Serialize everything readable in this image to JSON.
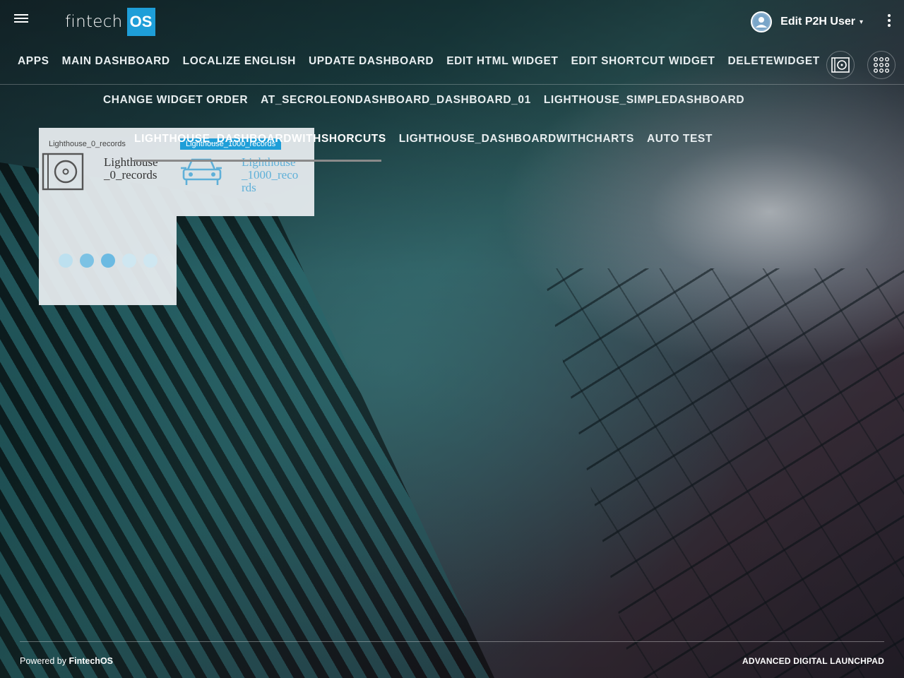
{
  "header": {
    "logo_text": "fintech",
    "logo_box": "OS",
    "user_name": "Edit P2H User",
    "caret": "▾"
  },
  "nav": {
    "row1": [
      "APPS",
      "MAIN DASHBOARD",
      "LOCALIZE ENGLISH",
      "UPDATE DASHBOARD",
      "EDIT HTML WIDGET",
      "EDIT SHORTCUT WIDGET",
      "DELETEWIDGET"
    ],
    "row2": [
      "CHANGE WIDGET ORDER",
      "AT_SECROLEONDASHBOARD_DASHBOARD_01",
      "LIGHTHOUSE_SIMPLEDASHBOARD"
    ],
    "row3": [
      "LIGHTHOUSE_DASHBOARDWITHSHORCUTS",
      "LIGHTHOUSE_DASHBOARDWITHCHARTS",
      "AUTO TEST"
    ],
    "active": "LIGHTHOUSE_DASHBOARDWITHSHORCUTS",
    "icons": [
      "media-icon",
      "apps-grid-icon"
    ]
  },
  "widgets": [
    {
      "title": "Lighthouse_0_records",
      "icon": "media-icon",
      "link_text": "Lighthouse_0_records",
      "loader_dots": 5
    },
    {
      "title": "Lighthouse_1000_records",
      "icon": "car-icon",
      "link_text": "Lighthouse_1000_records"
    }
  ],
  "footer": {
    "powered_prefix": "Powered by",
    "powered_brand": "FintechOS",
    "right_label": "ADVANCED DIGITAL LAUNCHPAD"
  },
  "colors": {
    "accent": "#1e9ed8",
    "widget_bg": "#e6ebee",
    "link_blue": "#5fb0d8"
  }
}
